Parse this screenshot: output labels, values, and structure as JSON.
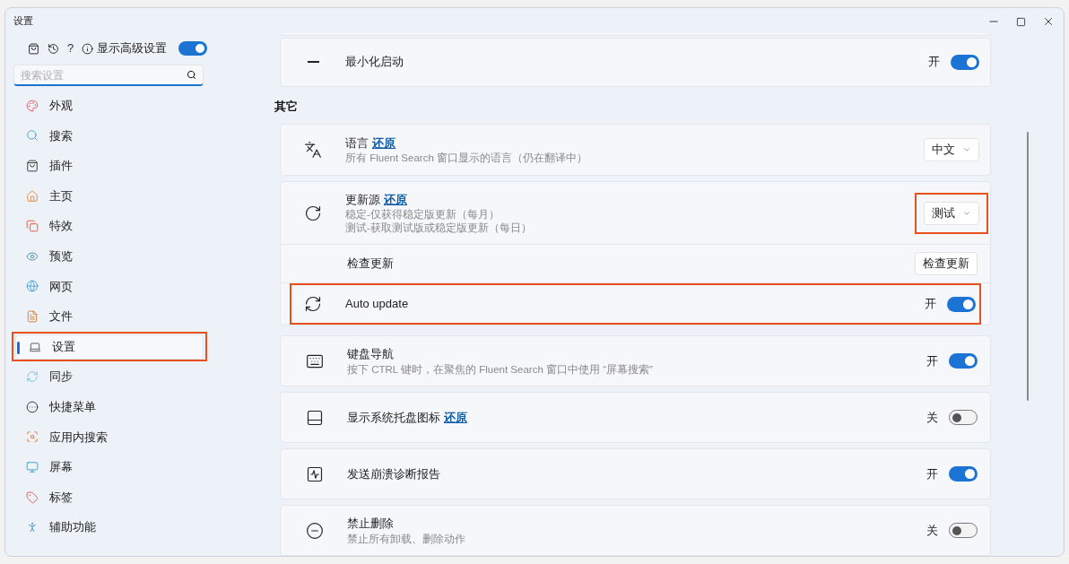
{
  "window": {
    "title": "设置"
  },
  "sidebar": {
    "toolbar": {
      "help": "?",
      "advanced_label": "显示高级设置",
      "advanced_on": true
    },
    "search": {
      "placeholder": "搜索设置"
    },
    "items": [
      {
        "label": "外观",
        "selected": false,
        "highlighted": false
      },
      {
        "label": "搜索",
        "selected": false,
        "highlighted": false
      },
      {
        "label": "插件",
        "selected": false,
        "highlighted": false
      },
      {
        "label": "主页",
        "selected": false,
        "highlighted": false
      },
      {
        "label": "特效",
        "selected": false,
        "highlighted": false
      },
      {
        "label": "预览",
        "selected": false,
        "highlighted": false
      },
      {
        "label": "网页",
        "selected": false,
        "highlighted": false
      },
      {
        "label": "文件",
        "selected": false,
        "highlighted": false
      },
      {
        "label": "设置",
        "selected": true,
        "highlighted": true
      },
      {
        "label": "同步",
        "selected": false,
        "highlighted": false
      },
      {
        "label": "快捷菜单",
        "selected": false,
        "highlighted": false
      },
      {
        "label": "应用内搜索",
        "selected": false,
        "highlighted": false
      },
      {
        "label": "屏幕",
        "selected": false,
        "highlighted": false
      },
      {
        "label": "标签",
        "selected": false,
        "highlighted": false
      },
      {
        "label": "辅助功能",
        "selected": false,
        "highlighted": false
      }
    ]
  },
  "top_card": {
    "title": "最小化启动",
    "toggle": {
      "label": "开",
      "on": true
    }
  },
  "section_title": "其它",
  "groups": [
    {
      "rows": [
        {
          "kind": "dropdown",
          "title": "语言",
          "link": "还原",
          "description": [
            "所有 Fluent Search 窗口显示的语言（仍在翻译中）"
          ],
          "value": "中文",
          "highlighted": false
        }
      ]
    },
    {
      "rows": [
        {
          "kind": "dropdown",
          "title": "更新源",
          "link": "还原",
          "description": [
            "稳定-仅获得稳定版更新（每月）",
            "测试-获取测试版或稳定版更新（每日）"
          ],
          "value": "测试",
          "highlighted": true
        },
        {
          "kind": "button",
          "title": "检查更新",
          "button": "检查更新",
          "highlighted": false
        },
        {
          "kind": "toggle",
          "title": "Auto update",
          "toggle": {
            "label": "开",
            "on": true
          },
          "highlighted": true
        }
      ]
    },
    {
      "rows": [
        {
          "kind": "toggle",
          "title": "键盘导航",
          "description": [
            "按下 CTRL 键时，在聚焦的 Fluent Search 窗口中使用 “屏幕搜索”"
          ],
          "toggle": {
            "label": "开",
            "on": true
          },
          "highlighted": false
        }
      ]
    },
    {
      "rows": [
        {
          "kind": "toggle",
          "title": "显示系统托盘图标",
          "link": "还原",
          "toggle": {
            "label": "关",
            "on": false
          },
          "highlighted": false
        }
      ]
    },
    {
      "rows": [
        {
          "kind": "toggle",
          "title": "发送崩溃诊断报告",
          "toggle": {
            "label": "开",
            "on": true
          },
          "highlighted": false
        }
      ]
    },
    {
      "rows": [
        {
          "kind": "toggle",
          "title": "禁止删除",
          "description": [
            "禁止所有卸载、删除动作"
          ],
          "toggle": {
            "label": "关",
            "on": false
          },
          "highlighted": false
        }
      ]
    }
  ]
}
